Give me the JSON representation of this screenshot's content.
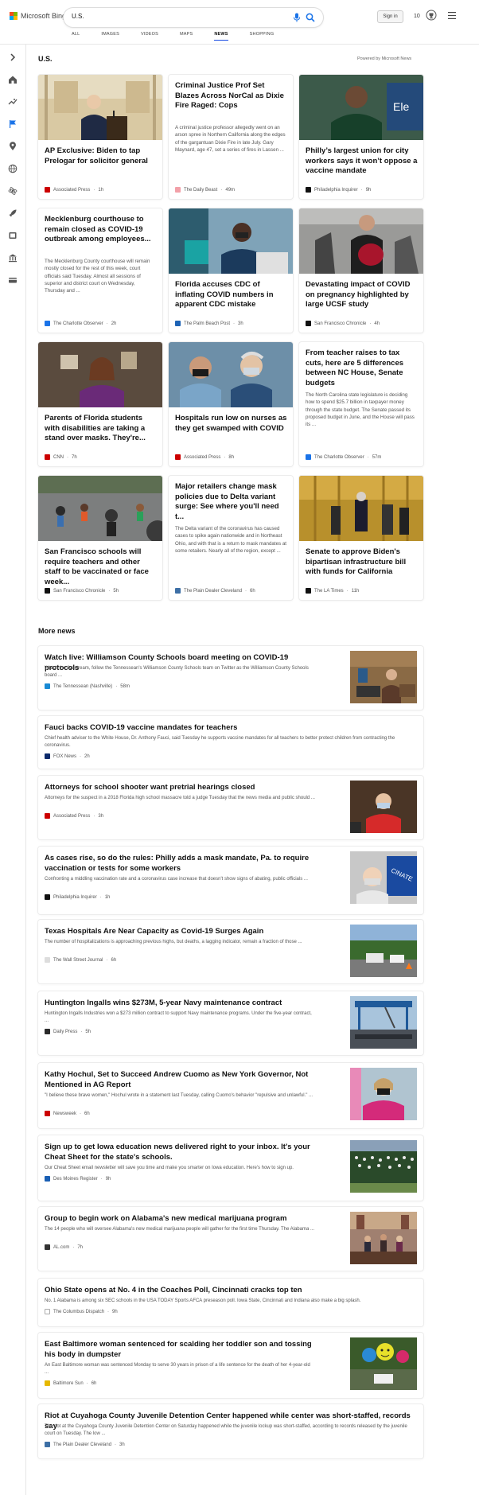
{
  "header": {
    "logo_text": "Microsoft Bing",
    "search_value": "U.S.",
    "signin_label": "Sign in",
    "rewards_count": "10"
  },
  "tabs": [
    "ALL",
    "IMAGES",
    "VIDEOS",
    "MAPS",
    "NEWS",
    "SHOPPING"
  ],
  "active_tab": "NEWS",
  "sidebar_icons": [
    "expand-icon",
    "home-icon",
    "trending-icon",
    "flag-icon",
    "location-icon",
    "globe-icon",
    "science-icon",
    "rocket-icon",
    "entertainment-icon",
    "politics-icon",
    "money-icon"
  ],
  "section": {
    "title": "U.S.",
    "powered_by": "Powered by Microsoft News"
  },
  "cards": [
    {
      "title": "AP Exclusive: Biden to tap Prelogar for solicitor general",
      "snippet": "",
      "source": "Associated Press",
      "time": "1h",
      "image": "biden-podium",
      "source_color": "#cc0000"
    },
    {
      "title": "Criminal Justice Prof Set Blazes Across NorCal as Dixie Fire Raged: Cops",
      "snippet": "A criminal justice professor allegedly went on an arson spree in Northern California along the edges of the gargantuan Dixie Fire in late July. Gary Maynard, age 47, set a series of fires in Lassen ...",
      "source": "The Daily Beast",
      "time": "49m",
      "image": "",
      "source_color": "#f2a0a8"
    },
    {
      "title": "Philly’s largest union for city workers says it won’t oppose a vaccine mandate",
      "snippet": "",
      "source": "Philadelphia Inquirer",
      "time": "9h",
      "image": "union-leader",
      "source_color": "#111111"
    },
    {
      "title": "Mecklenburg courthouse to remain closed as COVID-19 outbreak among employees...",
      "snippet": "The Mecklenburg County courthouse will remain mostly closed for the rest of this week, court officials said Tuesday. Almost all sessions of superior and district court on Wednesday, Thursday and ...",
      "source": "The Charlotte Observer",
      "time": "2h",
      "image": "",
      "source_color": "#1a73e8"
    },
    {
      "title": "Florida accuses CDC of inflating COVID numbers in apparent CDC mistake",
      "snippet": "",
      "source": "The Palm Beach Post",
      "time": "3h",
      "image": "nurse-testing",
      "source_color": "#1d63b5"
    },
    {
      "title": "Devastating impact of COVID on pregnancy highlighted by large UCSF study",
      "snippet": "",
      "source": "San Francisco Chronicle",
      "time": "4h",
      "image": "pregnant-woman",
      "source_color": "#111111"
    },
    {
      "title": "Parents of Florida students with disabilities are taking a stand over masks. They're...",
      "snippet": "",
      "source": "CNN",
      "time": "7h",
      "image": "parent-video",
      "source_color": "#cc0000"
    },
    {
      "title": "Hospitals run low on nurses as they get swamped with COVID",
      "snippet": "",
      "source": "Associated Press",
      "time": "8h",
      "image": "nurses-masks",
      "source_color": "#cc0000"
    },
    {
      "title": "From teacher raises to tax cuts, here are 5 differences between NC House, Senate budgets",
      "snippet": "The North Carolina state legislature is deciding how to spend $25.7 billion in taxpayer money through the state budget. The Senate passed its proposed budget in June, and the House will pass its ...",
      "source": "The Charlotte Observer",
      "time": "57m",
      "image": "",
      "source_color": "#1a73e8"
    },
    {
      "title": "San Francisco schools will require teachers and other staff to be vaccinated or face week...",
      "snippet": "",
      "source": "San Francisco Chronicle",
      "time": "5h",
      "image": "kids-playground",
      "source_color": "#111111"
    },
    {
      "title": "Major retailers change mask policies due to Delta variant surge: See where you'll need t...",
      "snippet": "The Delta variant of the coronavirus has caused cases to spike again nationwide and in Northeast Ohio, and with that is a return to mask mandates at some retailers. Nearly all of the region, except ...",
      "source": "The Plain Dealer Cleveland",
      "time": "6h",
      "image": "",
      "source_color": "#3d6fa5"
    },
    {
      "title": "Senate to approve Biden's bipartisan infrastructure bill with funds for California",
      "snippet": "",
      "source": "The LA Times",
      "time": "11h",
      "image": "senate-hall",
      "source_color": "#111111"
    }
  ],
  "more_news": {
    "title": "More news",
    "items": [
      {
        "title": "Watch live: Williamson County Schools board meeting on COVID-19 protocols",
        "snippet": "Watch the livestream, follow the Tennessean's Williamson County Schools team on Twitter as the Williamson County Schools board ...",
        "source": "The Tennessean (Nashville)",
        "time": "58m",
        "image": "board-meeting",
        "source_color": "#1a8ad4"
      },
      {
        "title": "Fauci backs COVID-19 vaccine mandates for teachers",
        "snippet": "Chief health adviser to the White House, Dr. Anthony Fauci, said Tuesday he supports vaccine mandates for all teachers to better protect children from contracting the coronavirus.",
        "source": "FOX News",
        "time": "2h",
        "image": "",
        "source_color": "#0c2a6b"
      },
      {
        "title": "Attorneys for school shooter want pretrial hearings closed",
        "snippet": "Attorneys for the suspect in a 2018 Florida high school massacre told a judge Tuesday that the news media and public should ...",
        "source": "Associated Press",
        "time": "3h",
        "image": "courtroom-red",
        "source_color": "#cc0000"
      },
      {
        "title": "As cases rise, so do the rules: Philly adds a mask mandate, Pa. to require vaccination or tests for some workers",
        "snippet": "Confronting a middling vaccination rate and a coronavirus case increase that doesn't show signs of abating, public officials ...",
        "source": "Philadelphia Inquirer",
        "time": "1h",
        "image": "vaccinate-sign",
        "source_color": "#111111"
      },
      {
        "title": "Texas Hospitals Are Near Capacity as Covid-19 Surges Again",
        "snippet": "The number of hospitalizations is approaching previous highs, but deaths, a lagging indicator, remain a fraction of those ...",
        "source": "The Wall Street Journal",
        "time": "6h",
        "image": "testing-site",
        "source_color": "#dddddd"
      },
      {
        "title": "Huntington Ingalls wins $273M, 5-year Navy maintenance contract",
        "snippet": "Huntington Ingalls Industries won a $273 million contract to support Navy maintenance programs. Under the five-year contract, ...",
        "source": "Daily Press",
        "time": "5h",
        "image": "shipyard",
        "source_color": "#2a2a2a"
      },
      {
        "title": "Kathy Hochul, Set to Succeed Andrew Cuomo as New York Governor, Not Mentioned in AG Report",
        "snippet": "\"I believe these brave women,\" Hochul wrote in a statement last Tuesday, calling Cuomo's behavior \"repulsive and unlawful.\" ...",
        "source": "Newsweek",
        "time": "6h",
        "image": "hochul",
        "source_color": "#cc0000"
      },
      {
        "title": "Sign up to get Iowa education news delivered right to your inbox. It's your Cheat Sheet for the state's schools.",
        "snippet": "Our Cheat Sheet email newsletter will save you time and make you smarter on Iowa education. Here's how to sign up.",
        "source": "Des Moines Register",
        "time": "9h",
        "image": "graduation",
        "source_color": "#1a5fb4"
      },
      {
        "title": "Group to begin work on Alabama's new medical marijuana program",
        "snippet": "The 14 people who will oversee Alabama's new medical marijuana people will gather for the first time Thursday. The Alabama ...",
        "source": "AL.com",
        "time": "7h",
        "image": "commission",
        "source_color": "#333333"
      },
      {
        "title": "Ohio State opens at No. 4 in the Coaches Poll, Cincinnati cracks top ten",
        "snippet": "No. 1 Alabama is among six SEC schools in the USA TODAY Sports AFCA preseason poll. Iowa State, Cincinnati and Indiana also make a big splash.",
        "source": "The Columbus Dispatch",
        "time": "9h",
        "image": "",
        "source_color": "#ffffff"
      },
      {
        "title": "East Baltimore woman sentenced for scalding her toddler son and tossing his body in dumpster",
        "snippet": "An East Baltimore woman was sentenced Monday to serve 30 years in prison of a life sentence for the death of her 4-year-old ...",
        "source": "Baltimore Sun",
        "time": "6h",
        "image": "balloons",
        "source_color": "#e6b800"
      },
      {
        "title": "Riot at Cuyahoga County Juvenile Detention Center happened while center was short-staffed, records say",
        "snippet": "The riot at the Cuyahoga County Juvenile Detention Center on Saturday happened while the juvenile lockup was short-staffed, according to records released by the juvenile court on Tuesday. The low ...",
        "source": "The Plain Dealer Cleveland",
        "time": "3h",
        "image": "",
        "source_color": "#3d6fa5"
      }
    ]
  }
}
